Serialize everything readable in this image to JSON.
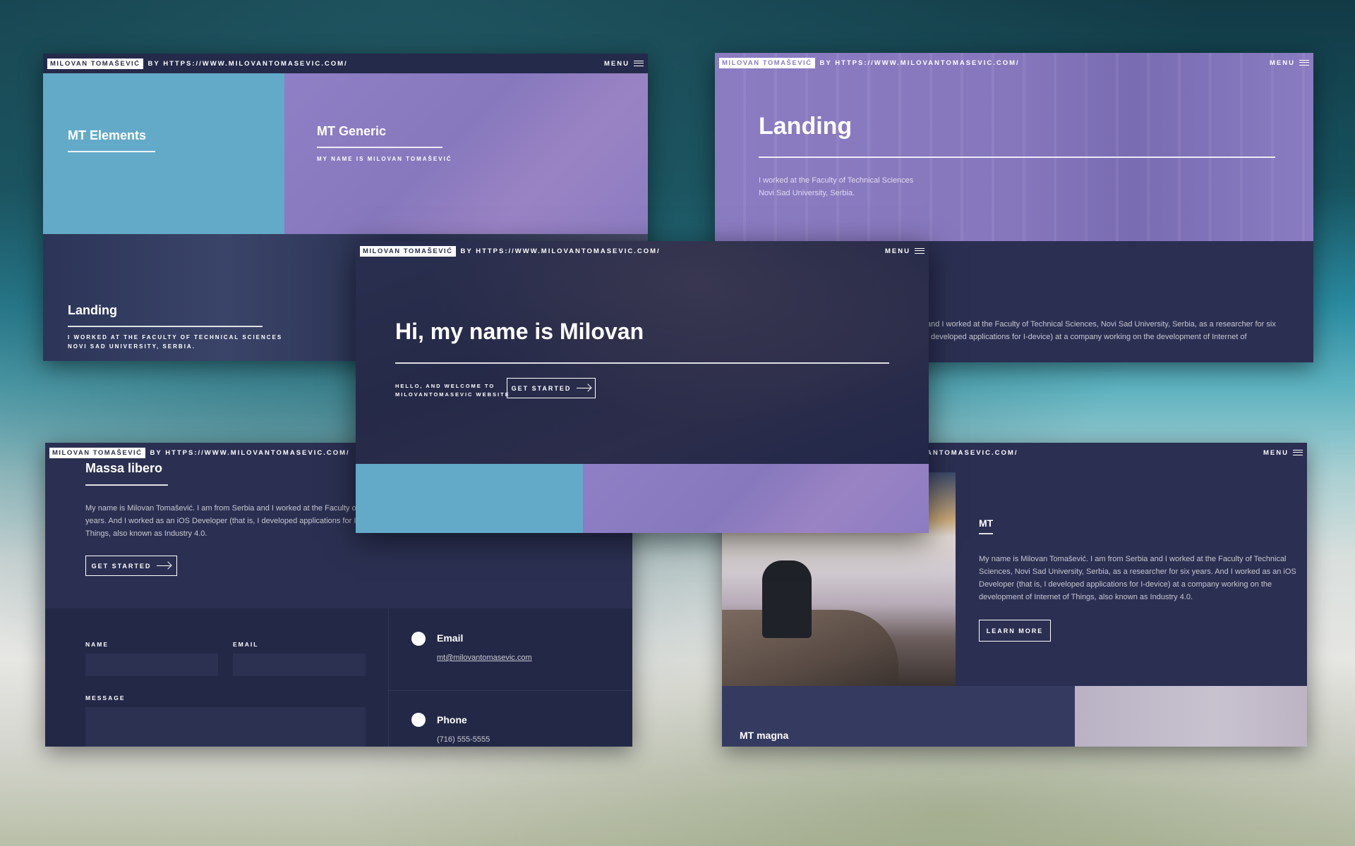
{
  "brand": "MILOVAN TOMAŠEVIĆ",
  "by_url": "BY HTTPS://WWW.MILOVANTOMASEVIC.COM/",
  "by_url_cut": "ANTOMASEVIC.COM/",
  "menu": "MENU",
  "card1": {
    "tile1_title": "MT Elements",
    "tile2_title": "MT Generic",
    "tile2_sub": "MY NAME IS MILOVAN TOMAŠEVIĆ",
    "tile3_title": "Landing",
    "tile3_sub1": "I WORKED AT THE FACULTY OF TECHNICAL SCIENCES",
    "tile3_sub2": "NOVI SAD UNIVERSITY, SERBIA."
  },
  "card2": {
    "title": "Landing",
    "line1": "I worked at the Faculty of Technical Sciences",
    "line2": "Novi Sad University, Serbia.",
    "para1": "and I worked at the Faculty of Technical Sciences, Novi Sad University, Serbia, as a researcher for six",
    "para2": "developed applications for I-device) at a company working on the development of Internet of"
  },
  "card3": {
    "title": "Massa libero",
    "para1": "My name is Milovan Tomašević. I am from Serbia and I worked at the Faculty of Te",
    "para2": "years. And I worked as an iOS Developer (that is, I developed applications for I-de",
    "para3": "Things, also known as Industry 4.0.",
    "button": "GET STARTED",
    "name_label": "NAME",
    "email_label": "EMAIL",
    "message_label": "MESSAGE",
    "email_title": "Email",
    "email_value": "mt@milovantomasevic.com",
    "phone_title": "Phone",
    "phone_value": "(716) 555-5555"
  },
  "card4": {
    "title": "MT",
    "para1": "My name is Milovan Tomašević. I am from Serbia and I worked at the Faculty of Technical",
    "para2": "Sciences, Novi Sad University, Serbia, as a researcher for six years. And I worked as an iOS",
    "para3": "Developer (that is, I developed applications for I-device) at a company working on the",
    "para4": "development of Internet of Things, also known as Industry 4.0.",
    "button": "LEARN MORE",
    "panel_title": "MT magna"
  },
  "card5": {
    "title": "Hi, my name is Milovan",
    "welcome1": "HELLO, AND WELCOME TO",
    "welcome2": "MILOVANTOMASEVIC WEBSITE",
    "button": "GET STARTED"
  }
}
